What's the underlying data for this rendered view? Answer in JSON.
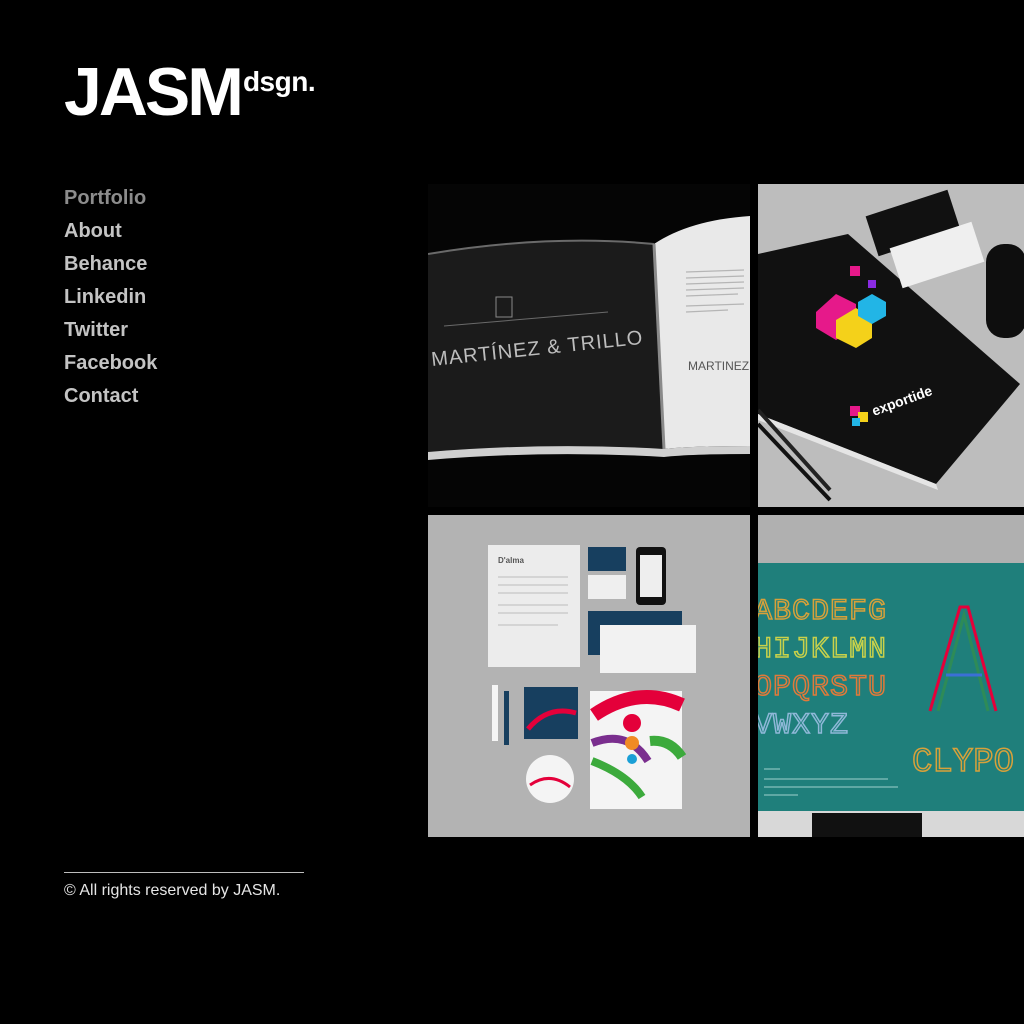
{
  "logo": {
    "main": "JASM",
    "sup": "dsgn."
  },
  "nav": [
    {
      "label": "Portfolio"
    },
    {
      "label": "About"
    },
    {
      "label": "Behance"
    },
    {
      "label": "Linkedin"
    },
    {
      "label": "Twitter"
    },
    {
      "label": "Facebook"
    },
    {
      "label": "Contact"
    }
  ],
  "portfolio": [
    {
      "caption": "MARTÍNEZ & TRILLO",
      "caption_right": "MARTINEZ"
    },
    {
      "brand": "exportide"
    },
    {
      "brand": "D'alma"
    },
    {
      "letters_row1": "ABCDEFG",
      "letters_row2": "HIJKLMN",
      "letters_row3": "OPQRSTU",
      "letters_row4": "VWXYZ",
      "big_letter": "A",
      "word": "CLYPO"
    }
  ],
  "footer": {
    "text": "© All rights reserved by JASM."
  },
  "colors": {
    "background": "#000000",
    "nav_text": "#c4c4c4",
    "nav_active": "#8c8c8c",
    "teal": "#1f7f7b"
  }
}
